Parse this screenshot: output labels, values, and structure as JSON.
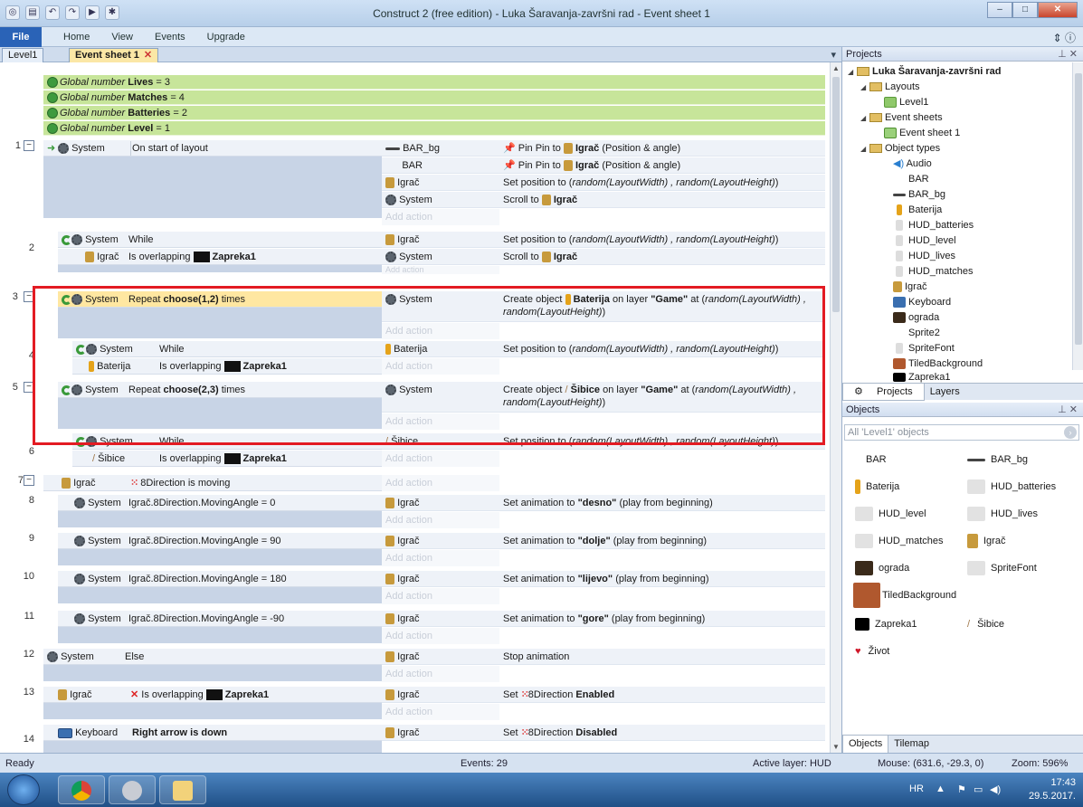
{
  "window": {
    "title": "Construct 2  (free edition) - Luka Šaravanja-završni rad - Event sheet 1"
  },
  "ribbon": {
    "file": "File",
    "tabs": [
      "Home",
      "View",
      "Events",
      "Upgrade"
    ]
  },
  "doc_tabs": [
    {
      "label": "Level1"
    },
    {
      "label": "Event sheet 1",
      "active": true
    }
  ],
  "globals": [
    {
      "prefix": "Global number",
      "name": "Lives",
      "value": "= 3"
    },
    {
      "prefix": "Global number",
      "name": "Matches",
      "value": "= 4"
    },
    {
      "prefix": "Global number",
      "name": "Batteries",
      "value": "= 2"
    },
    {
      "prefix": "Global number",
      "name": "Level",
      "value": "= 1"
    }
  ],
  "add_action": "Add action",
  "events": {
    "e1": {
      "num": "1",
      "obj": "System",
      "cond": "On start of layout",
      "actions": [
        {
          "obj": "BAR_bg",
          "text": "Pin Pin to",
          "target": "Igrač",
          "rest": "(Position & angle)"
        },
        {
          "obj": "BAR",
          "text": "Pin Pin to",
          "target": "Igrač",
          "rest": "(Position & angle)"
        },
        {
          "obj": "Igrač",
          "text": "Set position to (",
          "expr": "random(LayoutWidth) , random(LayoutHeight)",
          "close": ")"
        },
        {
          "obj": "System",
          "text": "Scroll to",
          "target": "Igrač"
        }
      ]
    },
    "e2": {
      "num": "2",
      "obj": "System",
      "cond": "While",
      "obj2": "Igrač",
      "cond2": "Is overlapping",
      "target2": "Zapreka1",
      "actions": [
        {
          "obj": "Igrač",
          "text": "Set position to (",
          "expr": "random(LayoutWidth) , random(LayoutHeight)",
          "close": ")"
        },
        {
          "obj": "System",
          "text": "Scroll to",
          "target": "Igrač"
        }
      ]
    },
    "e3": {
      "num": "3",
      "obj": "System",
      "cond_pre": "Repeat",
      "cond_bold": "choose(1,2)",
      "cond_post": "times",
      "act_obj": "System",
      "act_pre": "Create object",
      "act_target": "Baterija",
      "act_mid": "on layer",
      "act_layer": "\"Game\"",
      "act_at": "at (",
      "act_expr1": "random(LayoutWidth)",
      "act_expr2": ", random(LayoutHeight)",
      "act_close": ")"
    },
    "e4": {
      "num": "4",
      "obj": "System",
      "cond": "While",
      "obj2": "Baterija",
      "cond2": "Is overlapping",
      "target2": "Zapreka1",
      "act_obj": "Baterija",
      "act_text": "Set position to (",
      "act_expr": "random(LayoutWidth) , random(LayoutHeight)",
      "act_close": ")"
    },
    "e5": {
      "num": "5",
      "obj": "System",
      "cond_pre": "Repeat",
      "cond_bold": "choose(2,3)",
      "cond_post": "times",
      "act_obj": "System",
      "act_pre": "Create object",
      "act_target": "Šibice",
      "act_mid": "on layer",
      "act_layer": "\"Game\"",
      "act_at": "at (",
      "act_expr1": "random(LayoutWidth) ,",
      "act_expr2": "random(LayoutHeight)",
      "act_close": ")"
    },
    "e6": {
      "num": "6",
      "obj": "System",
      "cond": "While",
      "obj2": "Šibice",
      "cond2": "Is overlapping",
      "target2": "Zapreka1",
      "act_obj": "Šibice",
      "act_text": "Set position to (",
      "act_expr": "random(LayoutWidth) , random(LayoutHeight)",
      "act_close": ")"
    },
    "e7": {
      "num": "7",
      "obj": "Igrač",
      "cond": "8Direction is moving"
    },
    "e8": {
      "num": "8",
      "obj": "System",
      "cond": "Igrač.8Direction.MovingAngle = 0",
      "act_obj": "Igrač",
      "act_pre": "Set animation to",
      "act_bold": "\"desno\"",
      "act_post": "(play from beginning)"
    },
    "e9": {
      "num": "9",
      "obj": "System",
      "cond": "Igrač.8Direction.MovingAngle = 90",
      "act_obj": "Igrač",
      "act_pre": "Set animation to",
      "act_bold": "\"dolje\"",
      "act_post": "(play from beginning)"
    },
    "e10": {
      "num": "10",
      "obj": "System",
      "cond": "Igrač.8Direction.MovingAngle = 180",
      "act_obj": "Igrač",
      "act_pre": "Set animation to",
      "act_bold": "\"lijevo\"",
      "act_post": "(play from beginning)"
    },
    "e11": {
      "num": "11",
      "obj": "System",
      "cond": "Igrač.8Direction.MovingAngle = -90",
      "act_obj": "Igrač",
      "act_pre": "Set animation to",
      "act_bold": "\"gore\"",
      "act_post": "(play from beginning)"
    },
    "e12": {
      "num": "12",
      "obj": "System",
      "cond": "Else",
      "act_obj": "Igrač",
      "act_text": "Stop animation"
    },
    "e13": {
      "num": "13",
      "obj": "Igrač",
      "cond": "Is overlapping",
      "target": "Zapreka1",
      "act_obj": "Igrač",
      "act_pre": "Set",
      "act_target": "8Direction",
      "act_bold": "Enabled"
    },
    "e14": {
      "num": "14",
      "obj": "Keyboard",
      "cond": "Right arrow is down",
      "act_obj": "Igrač",
      "act_pre": "Set",
      "act_target": "8Direction",
      "act_bold": "Disabled"
    }
  },
  "projects": {
    "header": "Projects",
    "root": "Luka Šaravanja-završni rad",
    "layouts": "Layouts",
    "level1": "Level1",
    "event_sheets": "Event sheets",
    "event_sheet1": "Event sheet 1",
    "object_types": "Object types",
    "objects": [
      "Audio",
      "BAR",
      "BAR_bg",
      "Baterija",
      "HUD_batteries",
      "HUD_level",
      "HUD_lives",
      "HUD_matches",
      "Igrač",
      "Keyboard",
      "ograda",
      "Sprite2",
      "SpriteFont",
      "TiledBackground",
      "Zapreka1"
    ],
    "tabs": [
      "Projects",
      "Layers"
    ]
  },
  "objects_panel": {
    "header": "Objects",
    "filter": "All 'Level1' objects",
    "items": [
      "BAR",
      "BAR_bg",
      "Baterija",
      "HUD_batteries",
      "HUD_level",
      "HUD_lives",
      "HUD_matches",
      "Igrač",
      "ograda",
      "SpriteFont",
      "TiledBackground",
      "Zapreka1",
      "Šibice",
      "Život"
    ],
    "tabs": [
      "Objects",
      "Tilemap"
    ]
  },
  "status": {
    "left": "Ready",
    "events": "Events: 29",
    "layer": "Active layer: HUD",
    "mouse": "Mouse: (631.6, -29.3, 0)",
    "zoom": "Zoom: 596%"
  },
  "taskbar": {
    "lang": "HR",
    "time": "17:43",
    "date": "29.5.2017."
  }
}
